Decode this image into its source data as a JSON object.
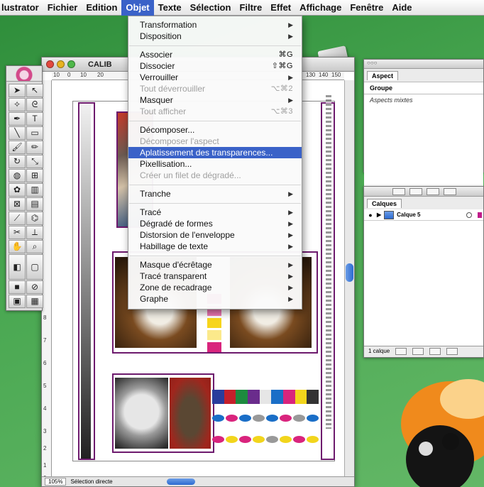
{
  "menubar": {
    "items": [
      "lustrator",
      "Fichier",
      "Edition",
      "Objet",
      "Texte",
      "Sélection",
      "Filtre",
      "Effet",
      "Affichage",
      "Fenêtre",
      "Aide"
    ]
  },
  "menu": {
    "items": [
      {
        "label": "Transformation",
        "shortcut": "",
        "submenu": true,
        "enabled": true
      },
      {
        "label": "Disposition",
        "shortcut": "",
        "submenu": true,
        "enabled": true
      },
      {
        "sep": true
      },
      {
        "label": "Associer",
        "shortcut": "⌘G",
        "submenu": false,
        "enabled": true
      },
      {
        "label": "Dissocier",
        "shortcut": "⇧⌘G",
        "submenu": false,
        "enabled": true
      },
      {
        "label": "Verrouiller",
        "shortcut": "",
        "submenu": true,
        "enabled": true
      },
      {
        "label": "Tout déverrouiller",
        "shortcut": "⌥⌘2",
        "submenu": false,
        "enabled": false
      },
      {
        "label": "Masquer",
        "shortcut": "",
        "submenu": true,
        "enabled": true
      },
      {
        "label": "Tout afficher",
        "shortcut": "⌥⌘3",
        "submenu": false,
        "enabled": false
      },
      {
        "sep": true
      },
      {
        "label": "Décomposer...",
        "shortcut": "",
        "submenu": false,
        "enabled": true
      },
      {
        "label": "Décomposer l'aspect",
        "shortcut": "",
        "submenu": false,
        "enabled": false
      },
      {
        "label": "Aplatissement des transparences...",
        "shortcut": "",
        "submenu": false,
        "enabled": true,
        "highlighted": true
      },
      {
        "label": "Pixellisation...",
        "shortcut": "",
        "submenu": false,
        "enabled": true
      },
      {
        "label": "Créer un filet de dégradé...",
        "shortcut": "",
        "submenu": false,
        "enabled": false
      },
      {
        "sep": true
      },
      {
        "label": "Tranche",
        "shortcut": "",
        "submenu": true,
        "enabled": true
      },
      {
        "sep": true
      },
      {
        "label": "Tracé",
        "shortcut": "",
        "submenu": true,
        "enabled": true
      },
      {
        "label": "Dégradé de formes",
        "shortcut": "",
        "submenu": true,
        "enabled": true
      },
      {
        "label": "Distorsion de l'enveloppe",
        "shortcut": "",
        "submenu": true,
        "enabled": true
      },
      {
        "label": "Habillage de texte",
        "shortcut": "",
        "submenu": true,
        "enabled": true
      },
      {
        "sep": true
      },
      {
        "label": "Masque d'écrêtage",
        "shortcut": "",
        "submenu": true,
        "enabled": true
      },
      {
        "label": "Tracé transparent",
        "shortcut": "",
        "submenu": true,
        "enabled": true
      },
      {
        "label": "Zone de recadrage",
        "shortcut": "",
        "submenu": true,
        "enabled": true
      },
      {
        "label": "Graphe",
        "shortcut": "",
        "submenu": true,
        "enabled": true
      }
    ]
  },
  "document": {
    "title": "CALIB",
    "ruler_ticks": [
      "10",
      "0",
      "10",
      "20",
      "130",
      "140",
      "150"
    ],
    "vruler_ticks": [
      "8",
      "7",
      "6",
      "5",
      "4",
      "3",
      "2",
      "1",
      "0"
    ],
    "zoom": "105%",
    "status": "Sélection directe"
  },
  "aspect_panel": {
    "tab": "Aspect",
    "rows": [
      "Groupe",
      "Aspects mixtes"
    ]
  },
  "layers_panel": {
    "tab": "Calques",
    "layer_name": "Calque 5",
    "footer": "1 calque"
  },
  "colors": {
    "accent": "#3a62c8",
    "frame": "#6d1a6d"
  }
}
